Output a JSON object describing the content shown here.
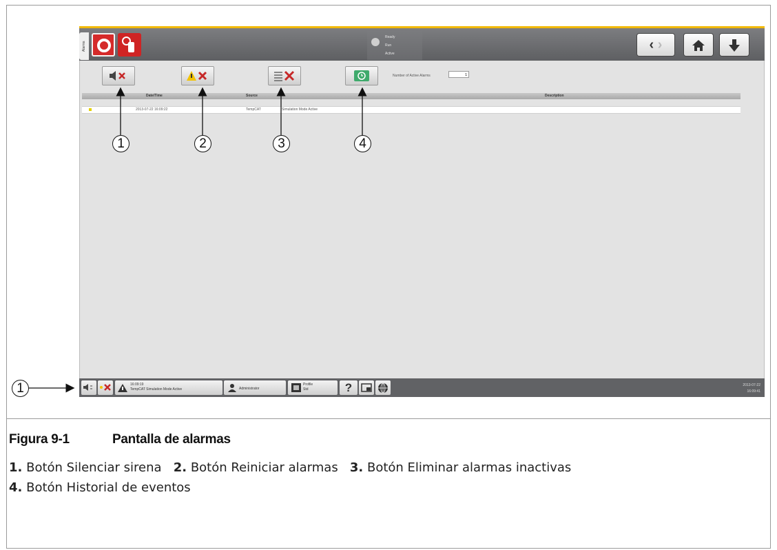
{
  "figure": {
    "number": "Figura 9-1",
    "title": "Pantalla de alarmas"
  },
  "legend": [
    {
      "num": "1.",
      "text": "Botón Silenciar sirena"
    },
    {
      "num": "2.",
      "text": "Botón Reiniciar alarmas"
    },
    {
      "num": "3.",
      "text": "Botón Eliminar alarmas inactivas"
    },
    {
      "num": "4.",
      "text": "Botón Historial de eventos"
    }
  ],
  "callouts": [
    "1",
    "2",
    "3",
    "4",
    "1"
  ],
  "screen": {
    "side_tab": "Alarms",
    "status_lines": [
      "Ready",
      "Run",
      "Active"
    ],
    "count_label": "Number of Active Alarms",
    "count_value": "1",
    "table": {
      "headers": [
        "Date/Time",
        "Source",
        "Description"
      ],
      "rows": [
        {
          "datetime": "2013-07-22 16:09:22",
          "source": "TempCAT",
          "description": "Simulation Mode Active"
        }
      ]
    },
    "bottom": {
      "alarm_time": "16:09:19",
      "alarm_text": "TempCAT Simulation Mode Active",
      "user_text": "Administrator",
      "profile_label": "Profile",
      "profile_value": "Std",
      "clock_lines": [
        "2013-07-22",
        "16:09:41"
      ]
    },
    "toolbar_icons": [
      "speaker-mute-icon",
      "warning-reset-icon",
      "list-delete-icon",
      "history-icon"
    ],
    "accent_color": "#f1b800",
    "brand_color": "#d52a2a"
  }
}
